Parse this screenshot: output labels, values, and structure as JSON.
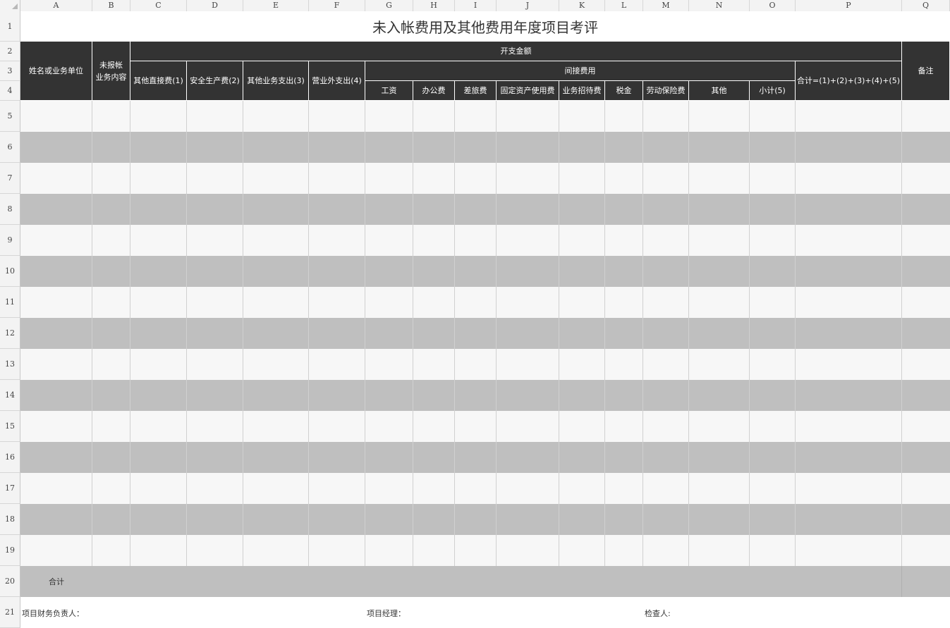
{
  "columns": [
    "A",
    "B",
    "C",
    "D",
    "E",
    "F",
    "G",
    "H",
    "I",
    "J",
    "K",
    "L",
    "M",
    "N",
    "O",
    "P",
    "Q"
  ],
  "rows": [
    "1",
    "2",
    "3",
    "4",
    "5",
    "6",
    "7",
    "8",
    "9",
    "10",
    "11",
    "12",
    "13",
    "14",
    "15",
    "16",
    "17",
    "18",
    "19",
    "20",
    "21"
  ],
  "title": "未入帐费用及其他费用年度项目考评",
  "header": {
    "name_unit": "姓名或业务单位",
    "unreported": "未报帐\n业务内容",
    "expense_amount": "开支金额",
    "indirect": "间接费用",
    "other_direct": "其他直接费(1)",
    "safety": "安全生产费(2)",
    "other_business": "其他业务支出(3)",
    "non_operating": "营业外支出(4)",
    "salary": "工资",
    "office": "办公费",
    "travel": "差旅费",
    "fixed_asset": "固定资产使用费",
    "entertain": "业务招待费",
    "tax": "税金",
    "labor_ins": "劳动保险费",
    "other": "其他",
    "subtotal": "小计(5)",
    "total_formula": "合计=(1)+(2)+(3)+(4)+(5)",
    "remark": "备注"
  },
  "total_label": "合计",
  "footer": {
    "finance_lead": "项目财务负责人：",
    "pm": "项目经理：",
    "inspector": "检查人:"
  },
  "colors": {
    "header_bg": "#333333",
    "band_grey": "#bfbfbf",
    "band_light": "#f7f7f7"
  }
}
